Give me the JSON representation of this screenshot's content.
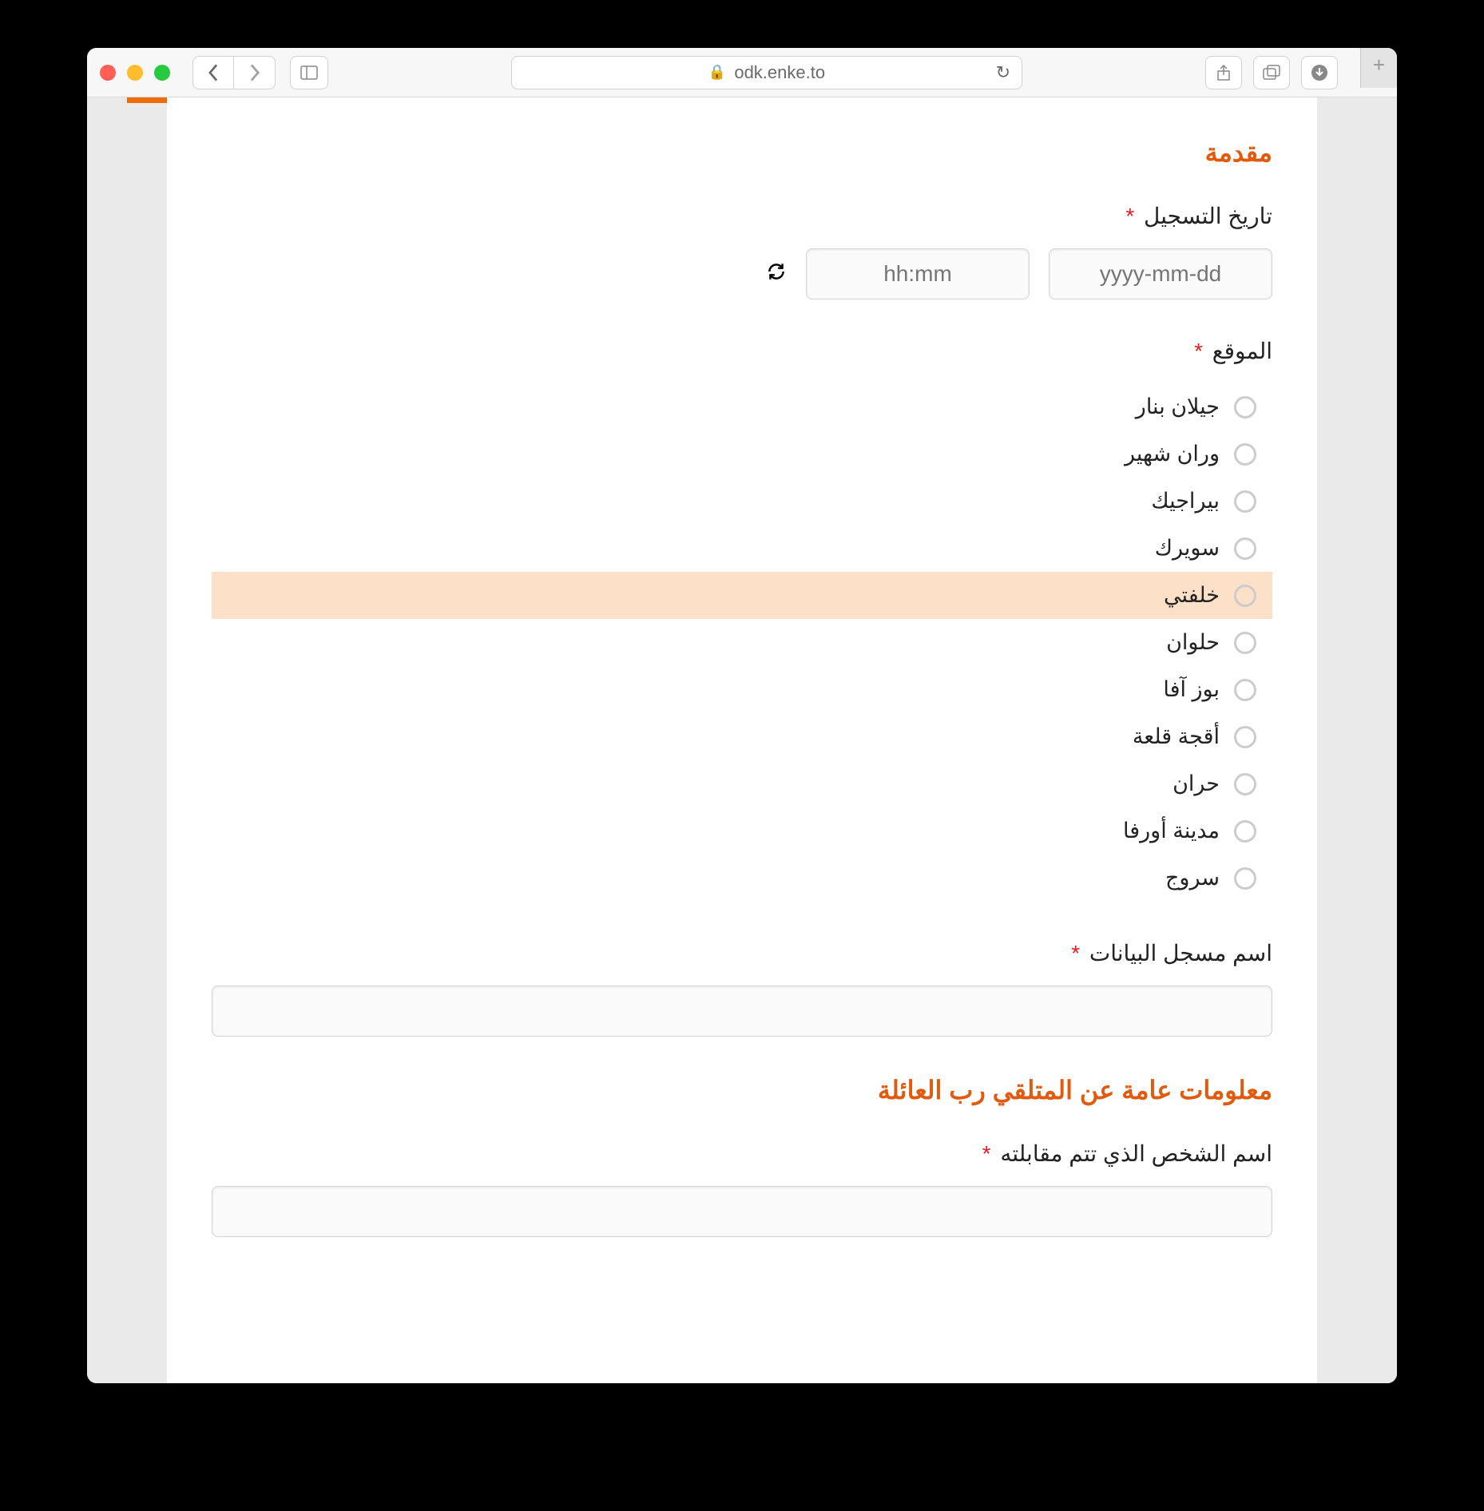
{
  "browser": {
    "url": "odk.enke.to"
  },
  "form": {
    "section1_title": "مقدمة",
    "q_reg_date": "تاريخ التسجيل",
    "date_placeholder": "yyyy-mm-dd",
    "time_placeholder": "hh:mm",
    "q_location": "الموقع",
    "locations": [
      {
        "label": "جيلان بنار",
        "highlight": false
      },
      {
        "label": "وران شهير",
        "highlight": false
      },
      {
        "label": "بيراجيك",
        "highlight": false
      },
      {
        "label": "سويرك",
        "highlight": false
      },
      {
        "label": "خلفتي",
        "highlight": true
      },
      {
        "label": "حلوان",
        "highlight": false
      },
      {
        "label": "بوز آفا",
        "highlight": false
      },
      {
        "label": "أقجة قلعة",
        "highlight": false
      },
      {
        "label": "حران",
        "highlight": false
      },
      {
        "label": "مدينة أورفا",
        "highlight": false
      },
      {
        "label": "سروج",
        "highlight": false
      }
    ],
    "q_recorder_name": "اسم مسجل البيانات",
    "section2_title": "معلومات عامة عن المتلقي رب العائلة",
    "q_interviewee_name": "اسم الشخص الذي تتم مقابلته"
  }
}
